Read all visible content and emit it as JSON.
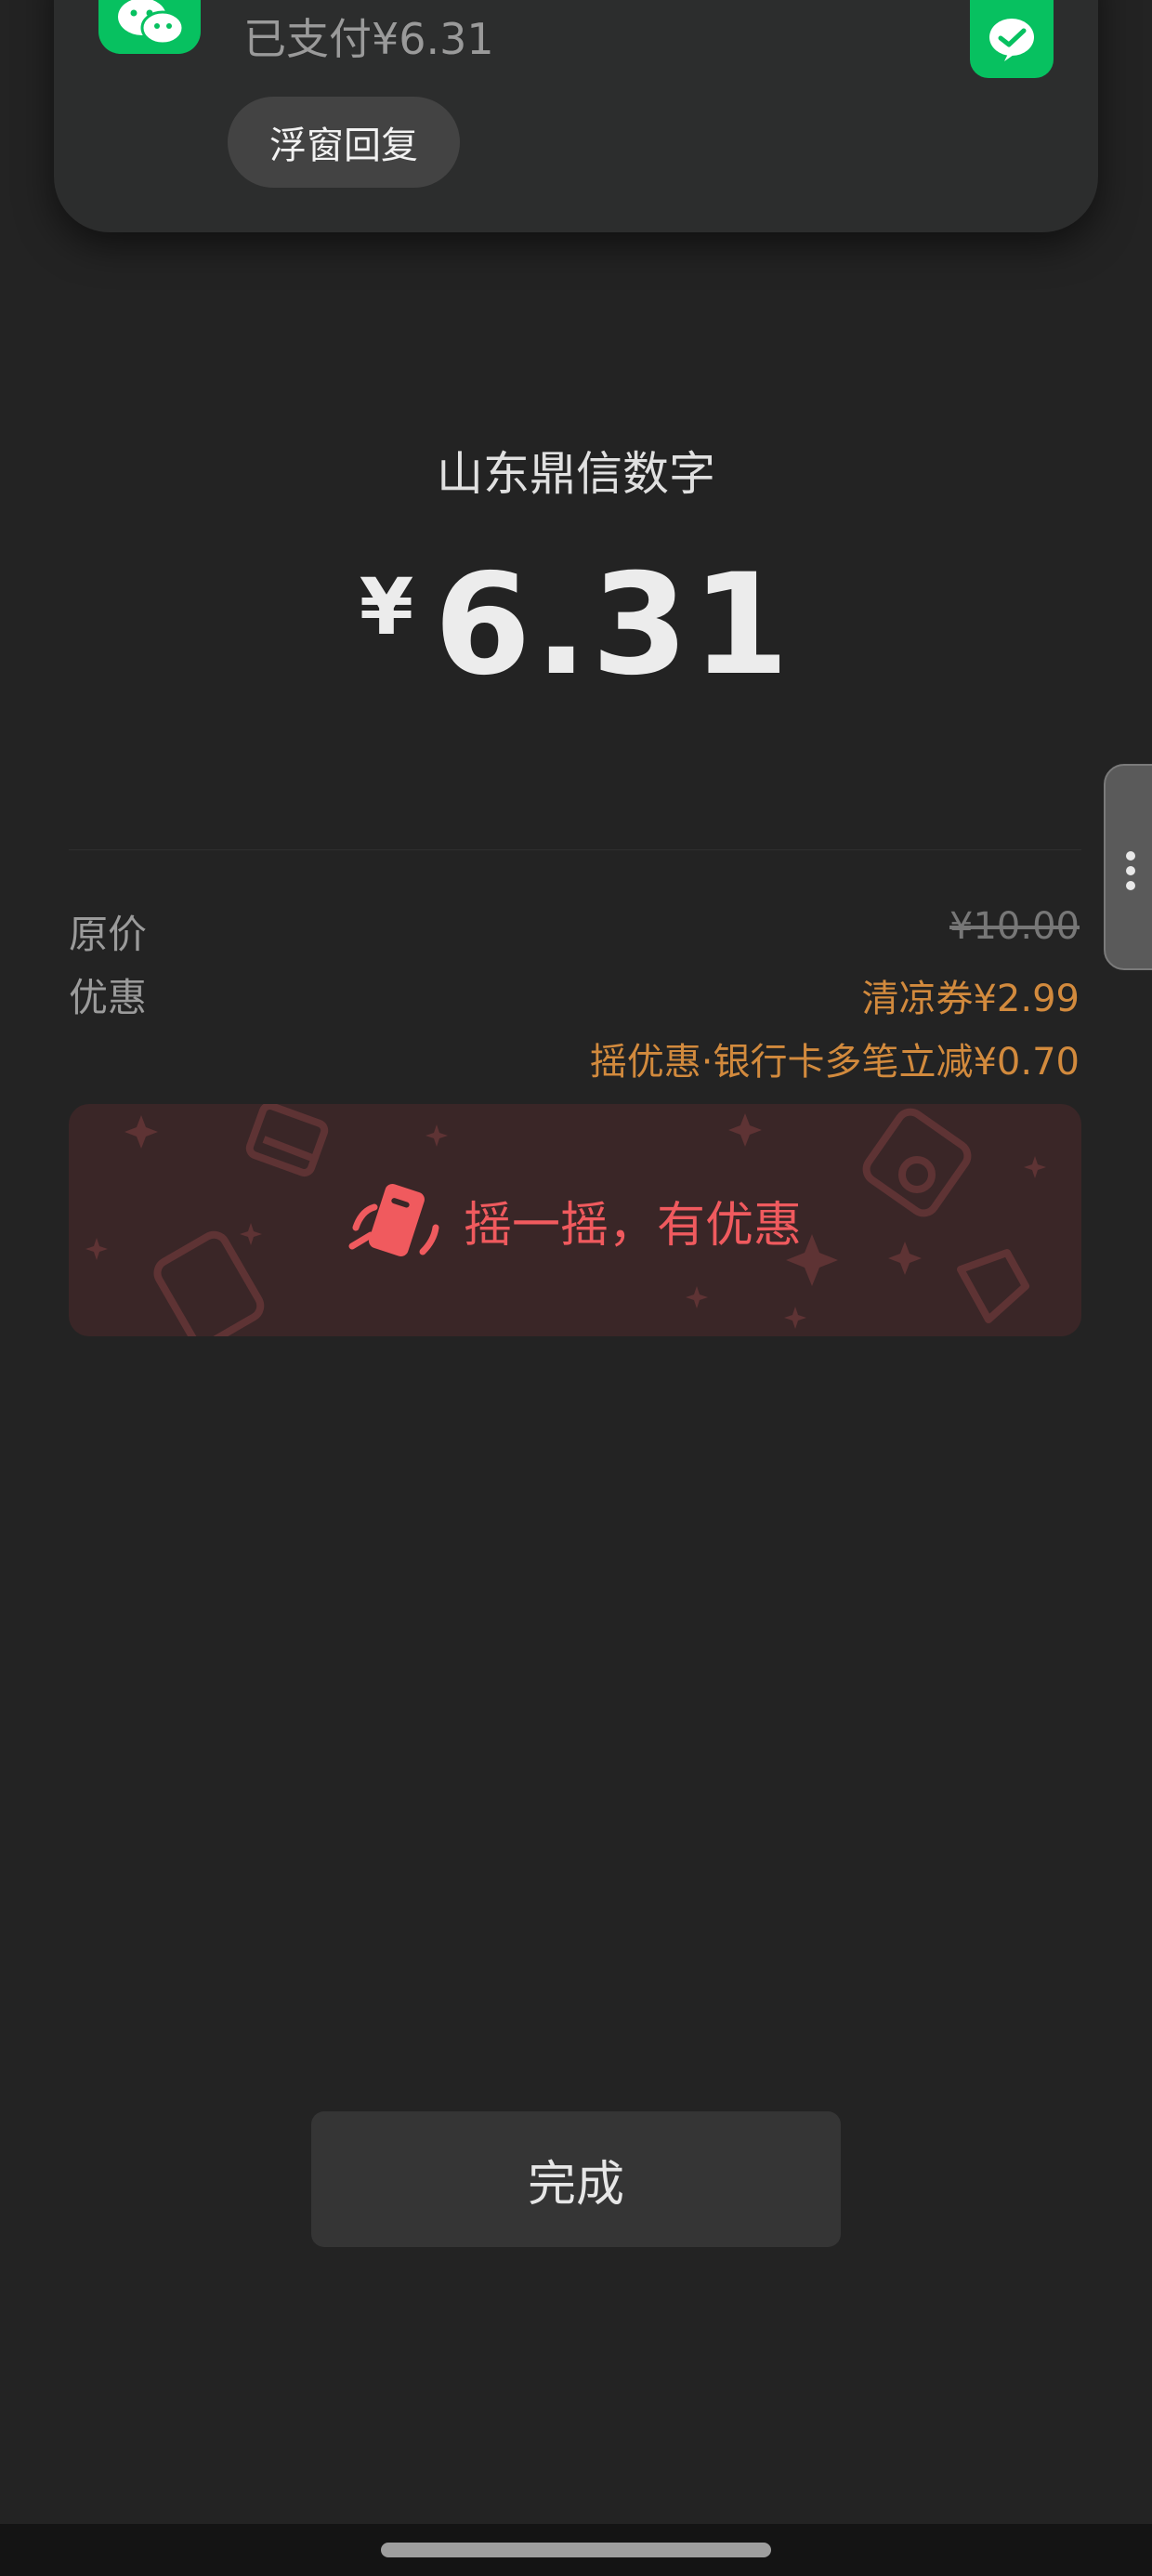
{
  "notification": {
    "message": "已支付¥6.31",
    "reply_button": "浮窗回复",
    "app_icon": "wechat-icon",
    "corner_icon": "wechat-pay-icon"
  },
  "payment": {
    "merchant": "山东鼎信数字",
    "currency_symbol": "¥",
    "amount": "6.31"
  },
  "details": {
    "original_label": "原价",
    "original_value": "¥10.00",
    "discount_label": "优惠",
    "coupon": "清凉券¥2.99",
    "bank_discount": "摇优惠·银行卡多笔立减¥0.70"
  },
  "shake_banner": {
    "text": "摇一摇，有优惠",
    "icon": "shake-phone-icon"
  },
  "done_button": "完成",
  "colors": {
    "background": "#232323",
    "wechat_green": "#07c160",
    "discount_orange": "#d28a3d",
    "shake_red": "#f05a5e"
  }
}
